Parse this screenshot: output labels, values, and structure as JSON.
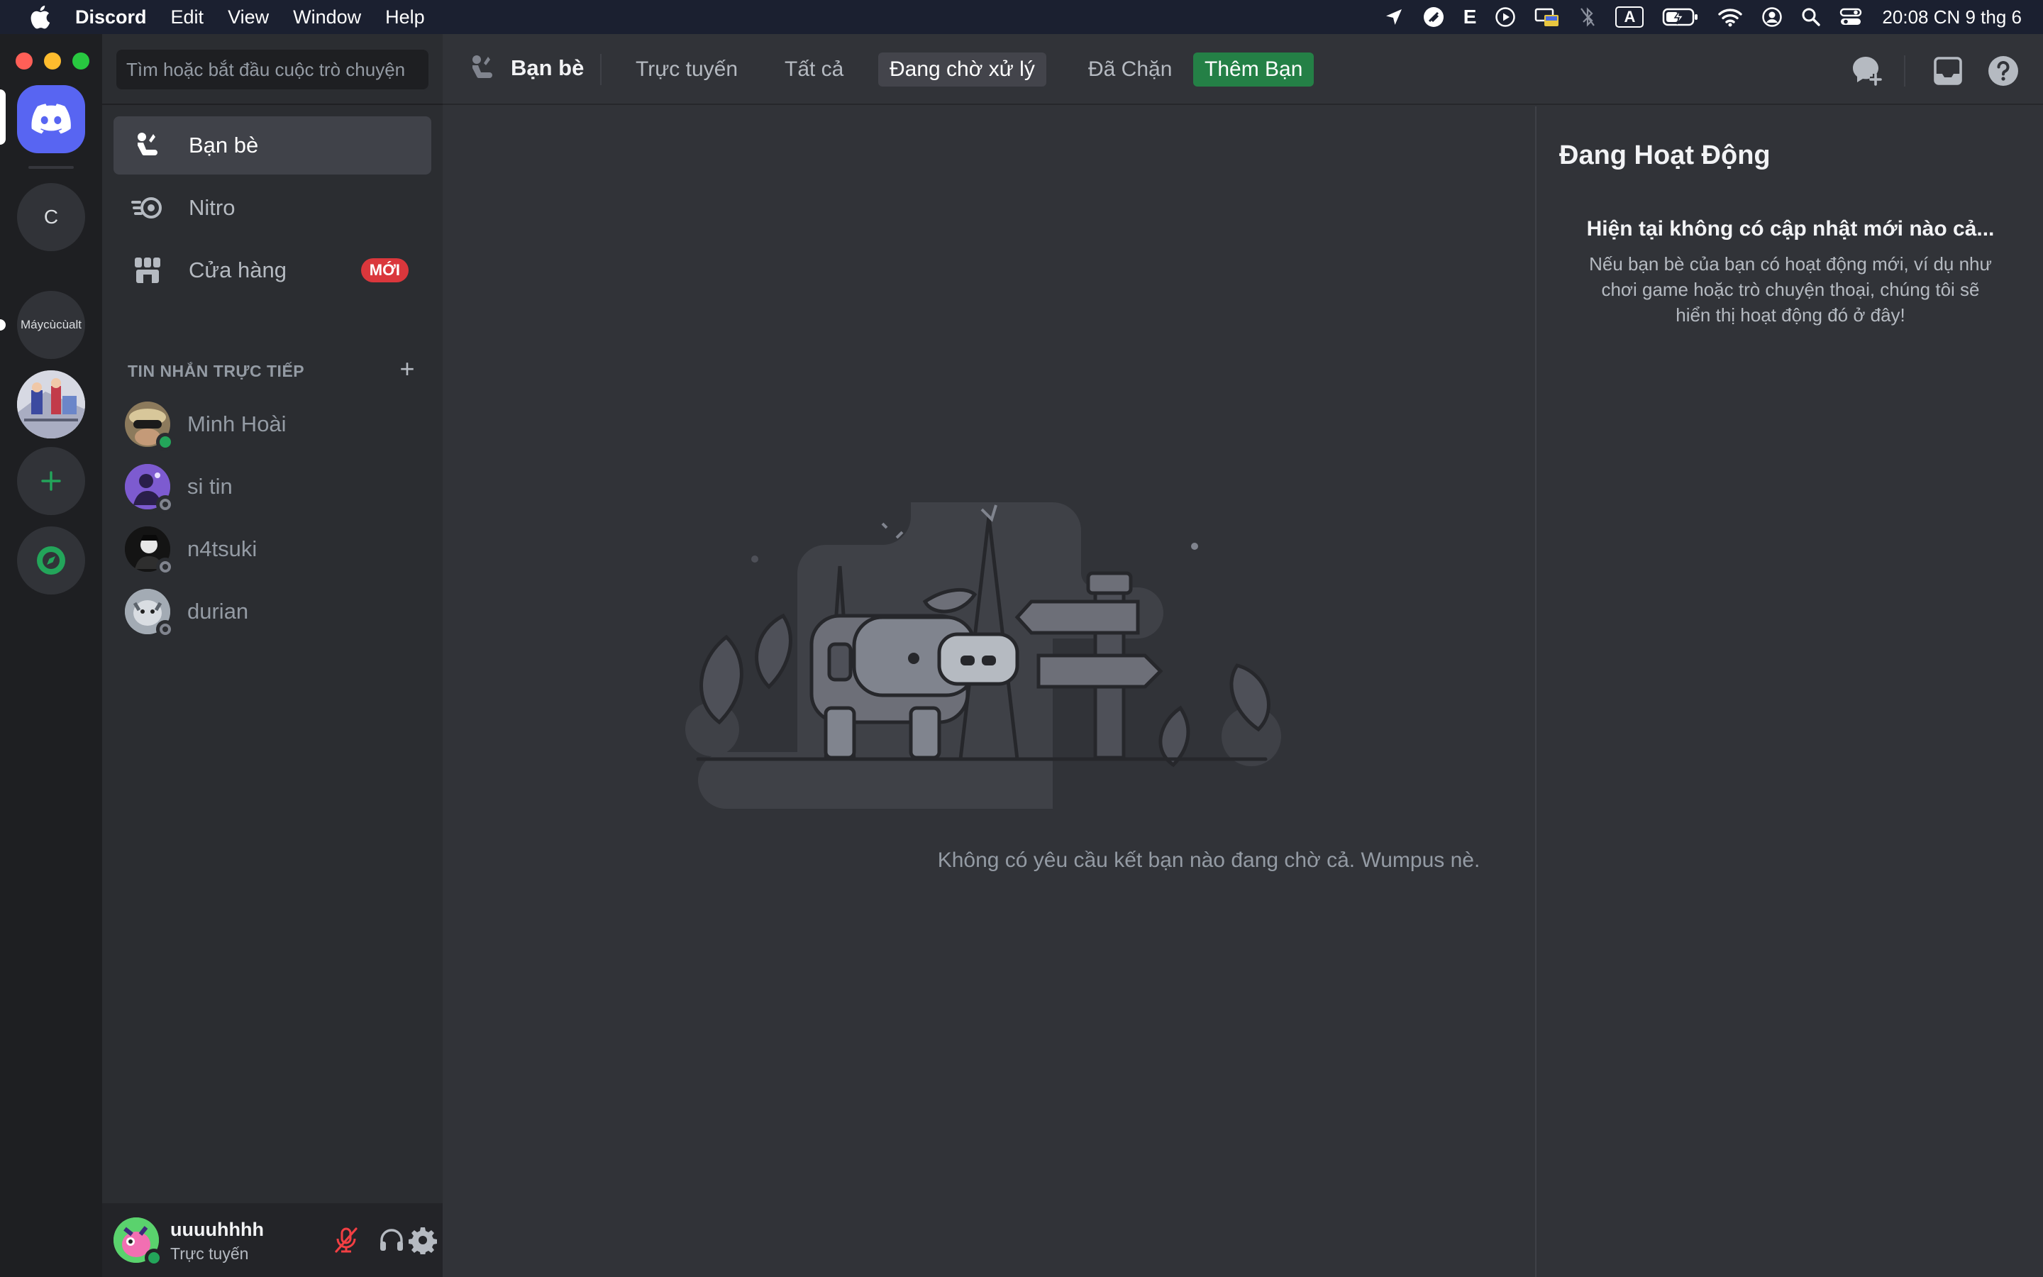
{
  "menubar": {
    "app_name": "Discord",
    "items": [
      "Edit",
      "View",
      "Window",
      "Help"
    ],
    "status_letter_e": "E",
    "input_source": "A",
    "clock": "20:08 CN 9 thg 6"
  },
  "rail": {
    "servers": [
      {
        "label": "C"
      },
      {
        "label": "Máycùcùalt"
      }
    ]
  },
  "sidebar": {
    "search_placeholder": "Tìm hoặc bắt đầu cuộc trò chuyện",
    "nav": {
      "friends": "Bạn bè",
      "nitro": "Nitro",
      "shop": "Cửa hàng",
      "shop_badge": "MỚI"
    },
    "dm_header": "TIN NHẮN TRỰC TIẾP",
    "dm_add": "+",
    "dms": [
      {
        "name": "Minh Hoài",
        "status": "online"
      },
      {
        "name": "si tin",
        "status": "offline"
      },
      {
        "name": "n4tsuki",
        "status": "offline"
      },
      {
        "name": "durian",
        "status": "offline"
      }
    ]
  },
  "user": {
    "name": "uuuuhhhh",
    "status": "Trực tuyến"
  },
  "topbar": {
    "title": "Bạn bè",
    "tabs": {
      "online": "Trực tuyến",
      "all": "Tất cả",
      "pending": "Đang chờ xử lý",
      "blocked": "Đã Chặn",
      "add_friend": "Thêm Bạn"
    }
  },
  "main": {
    "empty_text": "Không có yêu cầu kết bạn nào đang chờ cả. Wumpus nè."
  },
  "activity": {
    "title": "Đang Hoạt Động",
    "subtitle": "Hiện tại không có cập nhật mới nào cả...",
    "description": "Nếu bạn bè của bạn có hoạt động mới, ví dụ như chơi game hoặc trò chuyện thoại, chúng tôi sẽ hiển thị hoạt động đó ở đây!"
  },
  "colors": {
    "discord_blurple": "#5865f2",
    "online_green": "#23a55a",
    "add_friend_green": "#248046",
    "badge_red": "#da373c",
    "background_main": "#313338",
    "background_sidebar": "#2b2d31",
    "background_rail": "#1e1f22"
  }
}
